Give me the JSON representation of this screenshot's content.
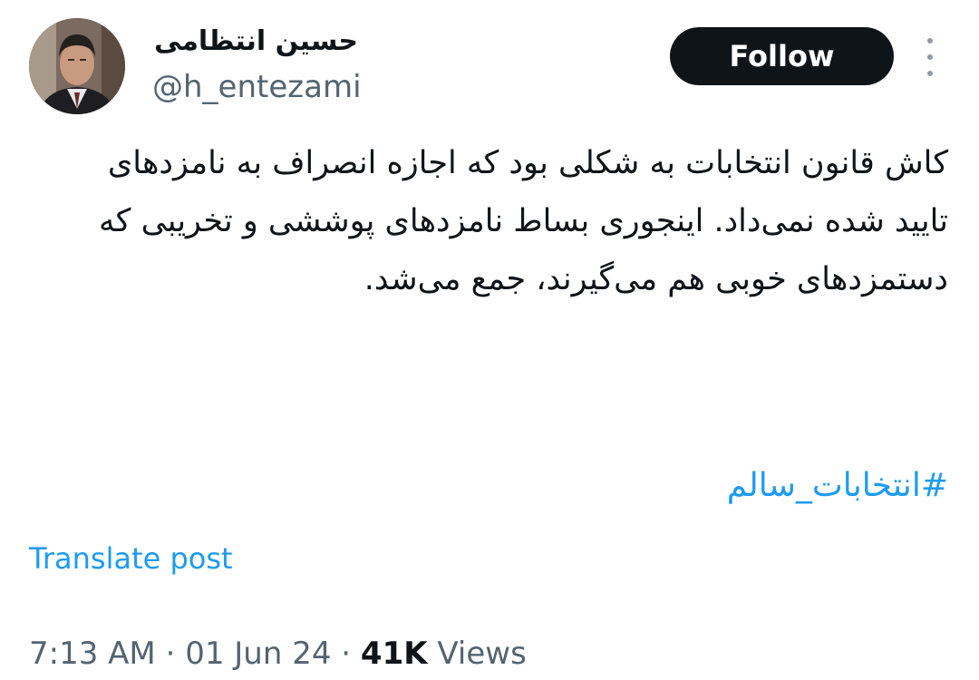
{
  "author": {
    "display_name": "حسین انتظامی",
    "handle": "@h_entezami"
  },
  "follow_button": {
    "label": "Follow"
  },
  "more_menu": {
    "icon": "more-vertical-icon"
  },
  "tweet": {
    "text": "کاش قانون انتخابات به شکلی بود که اجازه انصراف به نامزدهای تایید شده نمی‌داد. اینجوری بساط نامزدهای پوششی و تخریبی که دستمزدهای خوبی هم می‌گیرند، جمع می‌شد.",
    "hashtag": "#انتخابات_سالم",
    "translate_label": "Translate post"
  },
  "meta": {
    "time": "7:13 AM",
    "separator": "·",
    "date": "01 Jun 24",
    "views_count": "41K",
    "views_label": "Views"
  },
  "colors": {
    "link": "#1d9bf0",
    "text": "#0f1419",
    "secondary": "#536471",
    "button_bg": "#0f1419"
  }
}
